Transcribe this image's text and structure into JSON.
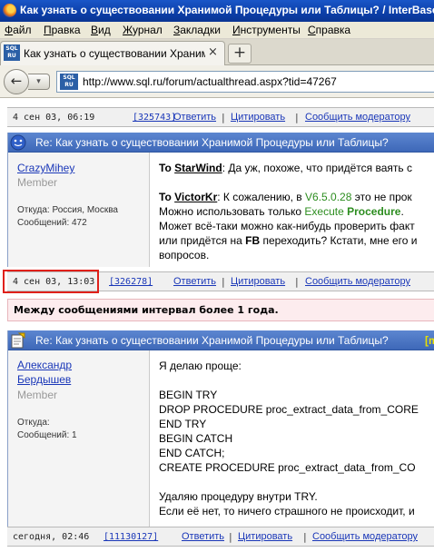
{
  "window": {
    "title": "Как узнать о существовании Хранимой Процедуры или Таблицы? / InterBase, F"
  },
  "menu": [
    "Файл",
    "Правка",
    "Вид",
    "Журнал",
    "Закладки",
    "Инструменты",
    "Справка"
  ],
  "tab": {
    "label": "Как узнать о существовании Хранимой П...",
    "close": "×",
    "new_tab": "+",
    "favicon_text": "SQL RU"
  },
  "nav": {
    "back": "←",
    "forward": "▾",
    "url": "http://www.sql.ru/forum/actualthread.aspx?tid=47267",
    "site_icon_text": "SQL RU"
  },
  "footers": [
    {
      "date": "4 сен 03, 06:19",
      "id": "[325743]",
      "reply": "Ответить",
      "quote": "Цитировать",
      "report": "Сообщить модератору"
    },
    {
      "date": "4 сен 03, 13:03",
      "id": "[326278]",
      "reply": "Ответить",
      "quote": "Цитировать",
      "report": "Сообщить модератору"
    },
    {
      "date": "сегодня, 02:46",
      "id": "[11130127]",
      "reply": "Ответить",
      "quote": "Цитировать",
      "report": "Сообщить модератору"
    }
  ],
  "post1": {
    "subject": "Re: Как узнать о существовании Хранимой Процедуры или Таблицы?",
    "author": "CrazyMihey",
    "role": "Member",
    "from": "Откуда: Россия, Москва",
    "messages": "Сообщений: 472",
    "to_label": "To",
    "to_user1": "StarWind",
    "text1": ": Да уж, похоже, что придётся ваять с",
    "to_user2": "VictorKr",
    "text2a": ": К сожалению, в ",
    "version": "V6.5.0.28",
    "text2b": " это не прок",
    "text3a": "Можно использовать только ",
    "execute": "Execute",
    "procedure": "Procedure",
    "text3b": ".",
    "text4": "Может всё-таки можно как-нибудь проверить факт",
    "text5a": "или придётся на ",
    "fb": "FB",
    "text5b": " переходить? Кстати, мне его и",
    "text6": "вопросов."
  },
  "gap_notice": "Между сообщениями интервал более 1 года.",
  "post2": {
    "subject": "Re: Как узнать о существовании Хранимой Процедуры или Таблицы?",
    "subject_tail": "[m",
    "author_line1": "Александр",
    "author_line2": "Бердышев",
    "role": "Member",
    "from": "Откуда:",
    "messages": "Сообщений: 1",
    "lines": [
      "Я делаю проще:",
      "",
      "BEGIN TRY",
      "DROP PROCEDURE proc_extract_data_from_CORE",
      "END TRY",
      "BEGIN CATCH",
      "END CATCH;",
      "CREATE PROCEDURE proc_extract_data_from_CO",
      "",
      "Удаляю процедуру внутри TRY.",
      "Если её нет, то ничего страшного не происходит, и"
    ]
  },
  "colors": {
    "header_blue": "#4a74c4",
    "link_blue": "#1a37b8",
    "highlight_red": "#e0201a",
    "version_green": "#2c8d1f"
  }
}
